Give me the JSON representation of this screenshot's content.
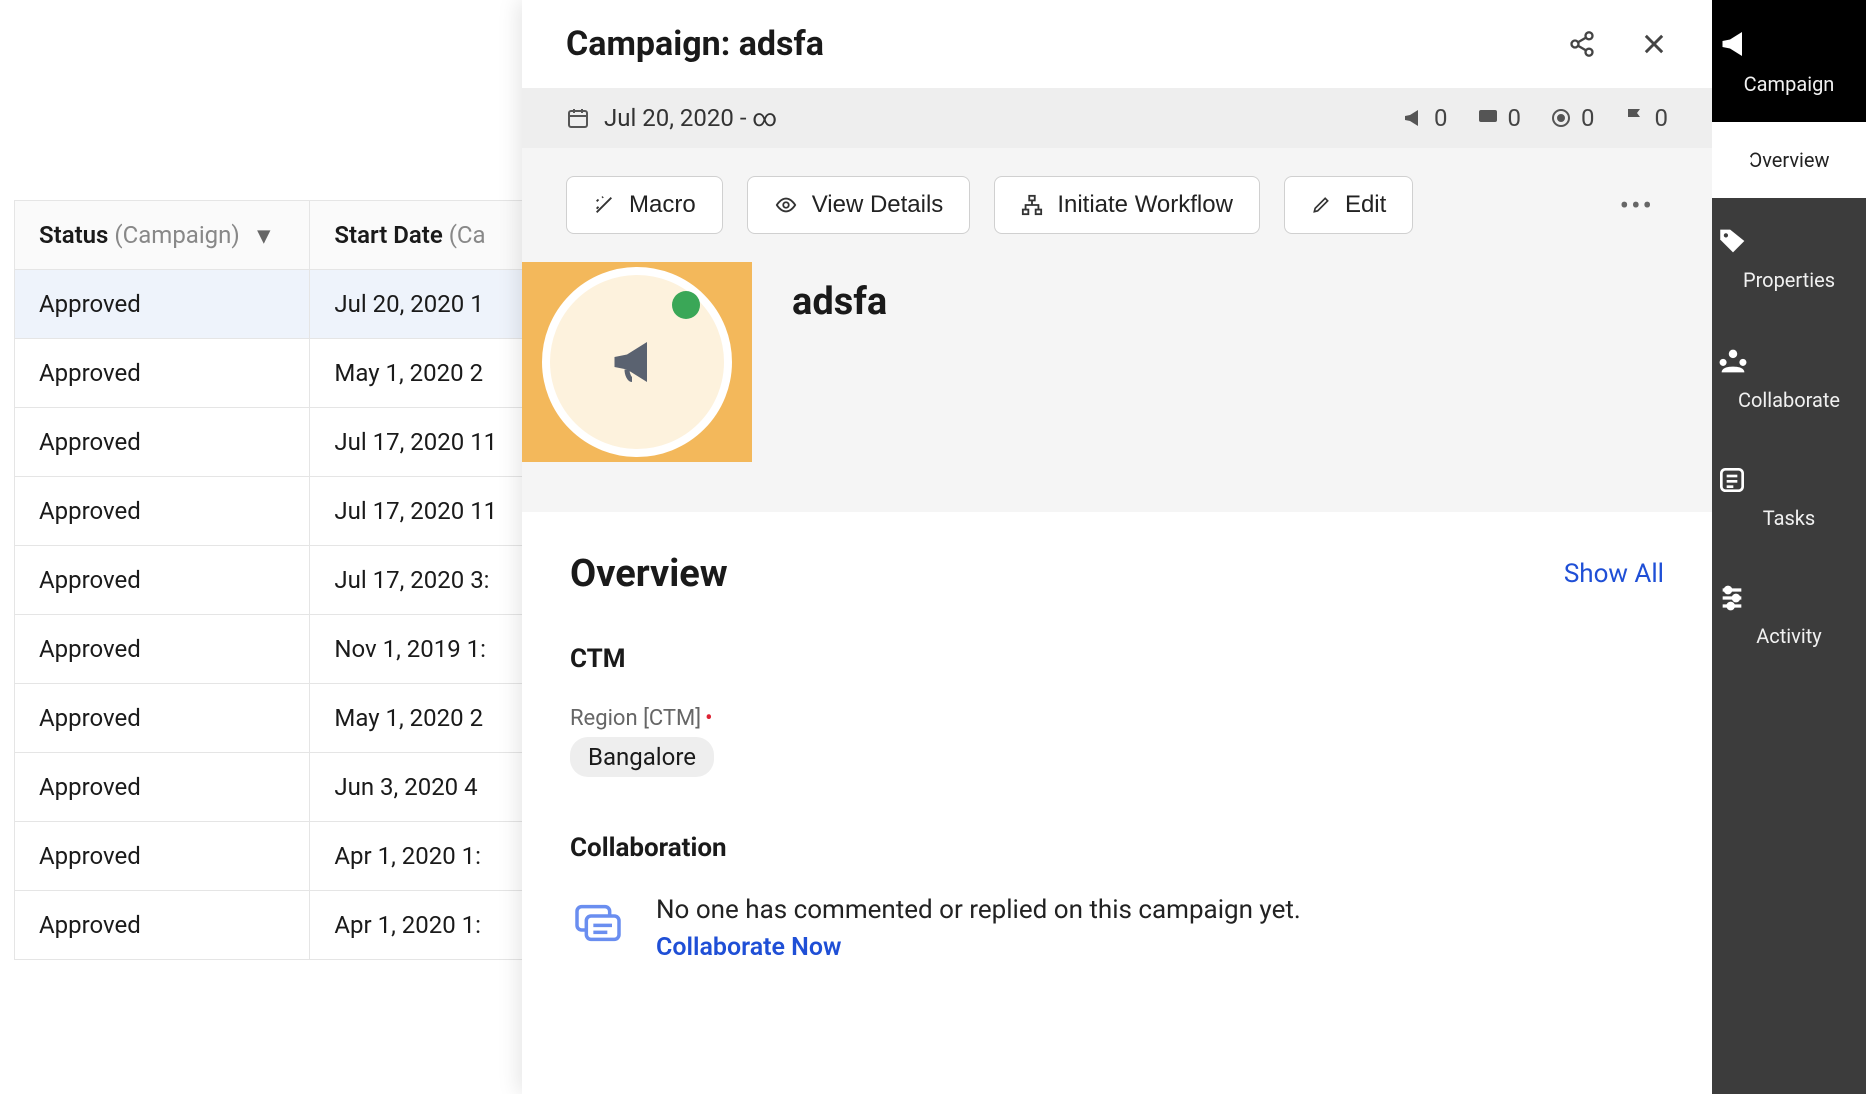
{
  "table": {
    "columns": [
      {
        "label": "Status",
        "category": "(Campaign)"
      },
      {
        "label": "Start Date",
        "category": "(Ca"
      }
    ],
    "rows": [
      {
        "status": "Approved",
        "date": "Jul 20, 2020 1"
      },
      {
        "status": "Approved",
        "date": "May 1, 2020 2"
      },
      {
        "status": "Approved",
        "date": "Jul 17, 2020 11"
      },
      {
        "status": "Approved",
        "date": "Jul 17, 2020 11"
      },
      {
        "status": "Approved",
        "date": "Jul 17, 2020 3:"
      },
      {
        "status": "Approved",
        "date": "Nov 1, 2019 1:"
      },
      {
        "status": "Approved",
        "date": "May 1, 2020 2"
      },
      {
        "status": "Approved",
        "date": "Jun 3, 2020 4"
      },
      {
        "status": "Approved",
        "date": "Apr 1, 2020 1:"
      },
      {
        "status": "Approved",
        "date": "Apr 1, 2020 1:"
      }
    ]
  },
  "panel": {
    "title": "Campaign: adsfa",
    "date": "Jul 20, 2020 - ∞",
    "stats": {
      "announce": "0",
      "chat": "0",
      "target": "0",
      "flag": "0"
    },
    "toolbar": {
      "macro": "Macro",
      "view_details": "View Details",
      "initiate_workflow": "Initiate Workflow",
      "edit": "Edit"
    },
    "hero_title": "adsfa",
    "overview": {
      "heading": "Overview",
      "show_all": "Show All",
      "ctm_label": "CTM",
      "region_label": "Region [CTM]",
      "region_value": "Bangalore",
      "collab_heading": "Collaboration",
      "collab_empty": "No one has commented or replied on this campaign yet.",
      "collab_cta": "Collaborate Now"
    }
  },
  "sidebar": {
    "items": [
      {
        "label": "Campaign"
      },
      {
        "label": "Overview"
      },
      {
        "label": "Properties"
      },
      {
        "label": "Collaborate"
      },
      {
        "label": "Tasks"
      },
      {
        "label": "Activity"
      }
    ]
  }
}
